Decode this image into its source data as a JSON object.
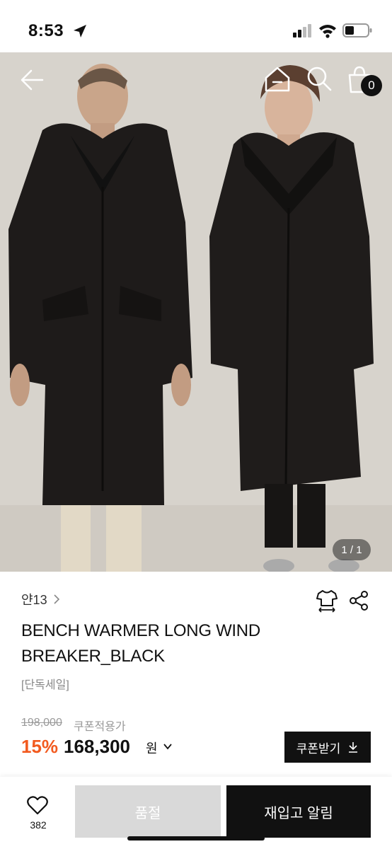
{
  "status_bar": {
    "time": "8:53"
  },
  "header": {
    "cart_count": "0"
  },
  "gallery": {
    "counter": "1 / 1"
  },
  "product": {
    "brand": "얀13",
    "title": "BENCH WARMER LONG WIND BREAKER_BLACK",
    "tag": "[단독세일]",
    "original_price": "198,000",
    "coupon_note": "쿠폰적용가",
    "discount": "15%",
    "final_price": "168,300",
    "currency": "원",
    "coupon_button": "쿠폰받기"
  },
  "bottom_bar": {
    "like_count": "382",
    "soldout_label": "품절",
    "restock_label": "재입고 알림"
  },
  "colors": {
    "accent": "#f25a1f",
    "dark": "#111111",
    "soldout": "#d9d9d9"
  }
}
